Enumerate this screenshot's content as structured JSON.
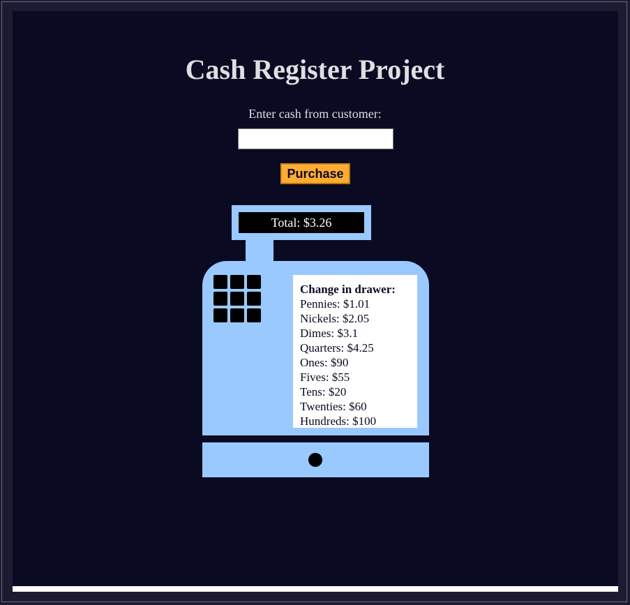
{
  "page": {
    "title": "Cash Register Project"
  },
  "form": {
    "cash_label": "Enter cash from customer:",
    "cash_value": "",
    "purchase_label": "Purchase"
  },
  "register": {
    "total_text": "Total: $3.26",
    "drawer": {
      "heading": "Change in drawer:",
      "items": [
        "Pennies: $1.01",
        "Nickels: $2.05",
        "Dimes: $3.1",
        "Quarters: $4.25",
        "Ones: $90",
        "Fives: $55",
        "Tens: $20",
        "Twenties: $60",
        "Hundreds: $100"
      ]
    },
    "keypad_key_count": 9
  },
  "colors": {
    "page_background": "#0a0a23",
    "outer_background": "#1b1b32",
    "text": "#dfdfe2",
    "accent_button": "#feac32",
    "register_blue": "#99c9ff",
    "screen_black": "#000000"
  },
  "icons": {
    "drawer_knob": "knob-icon",
    "keypad": "keypad-icon"
  }
}
